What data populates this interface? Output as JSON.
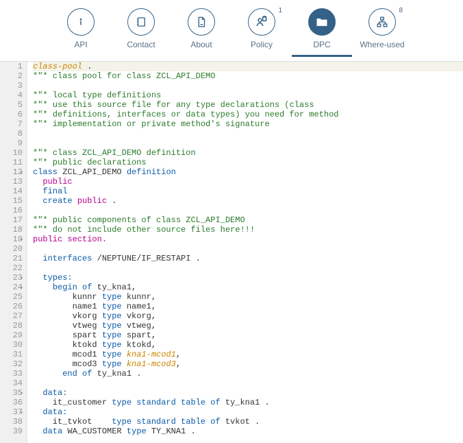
{
  "tabs": [
    {
      "id": "api",
      "label": "API",
      "icon": "info-icon",
      "badge": null,
      "active": false
    },
    {
      "id": "contact",
      "label": "Contact",
      "icon": "contact-icon",
      "badge": null,
      "active": false
    },
    {
      "id": "about",
      "label": "About",
      "icon": "document-icon",
      "badge": null,
      "active": false
    },
    {
      "id": "policy",
      "label": "Policy",
      "icon": "policy-icon",
      "badge": "1",
      "active": false
    },
    {
      "id": "dpc",
      "label": "DPC",
      "icon": "folder-icon",
      "badge": null,
      "active": true
    },
    {
      "id": "where-used",
      "label": "Where-used",
      "icon": "hierarchy-icon",
      "badge": "8",
      "active": false
    }
  ],
  "code_lines": [
    {
      "n": 1,
      "fold": "",
      "hl": true,
      "tokens": [
        [
          "cp",
          "class-pool"
        ],
        [
          "ident",
          " ."
        ]
      ]
    },
    {
      "n": 2,
      "fold": "",
      "hl": false,
      "tokens": [
        [
          "cmt",
          "*\"* class pool for class ZCL_API_DEMO"
        ]
      ]
    },
    {
      "n": 3,
      "fold": "",
      "hl": false,
      "tokens": [
        [
          "ident",
          ""
        ]
      ]
    },
    {
      "n": 4,
      "fold": "",
      "hl": false,
      "tokens": [
        [
          "cmt",
          "*\"* local type definitions"
        ]
      ]
    },
    {
      "n": 5,
      "fold": "",
      "hl": false,
      "tokens": [
        [
          "cmt",
          "*\"* use this source file for any type declarations (class"
        ]
      ]
    },
    {
      "n": 6,
      "fold": "",
      "hl": false,
      "tokens": [
        [
          "cmt",
          "*\"* definitions, interfaces or data types) you need for method"
        ]
      ]
    },
    {
      "n": 7,
      "fold": "",
      "hl": false,
      "tokens": [
        [
          "cmt",
          "*\"* implementation or private method's signature"
        ]
      ]
    },
    {
      "n": 8,
      "fold": "",
      "hl": false,
      "tokens": [
        [
          "ident",
          ""
        ]
      ]
    },
    {
      "n": 9,
      "fold": "",
      "hl": false,
      "tokens": [
        [
          "ident",
          ""
        ]
      ]
    },
    {
      "n": 10,
      "fold": "",
      "hl": false,
      "tokens": [
        [
          "cmt",
          "*\"* class ZCL_API_DEMO definition"
        ]
      ]
    },
    {
      "n": 11,
      "fold": "",
      "hl": false,
      "tokens": [
        [
          "cmt",
          "*\"* public declarations"
        ]
      ]
    },
    {
      "n": 12,
      "fold": "▾",
      "hl": false,
      "tokens": [
        [
          "kw",
          "class "
        ],
        [
          "ident",
          "ZCL_API_DEMO "
        ],
        [
          "kw",
          "definition"
        ]
      ]
    },
    {
      "n": 13,
      "fold": "",
      "hl": false,
      "tokens": [
        [
          "ident",
          "  "
        ],
        [
          "vis",
          "public"
        ]
      ]
    },
    {
      "n": 14,
      "fold": "",
      "hl": false,
      "tokens": [
        [
          "ident",
          "  "
        ],
        [
          "kw",
          "final"
        ]
      ]
    },
    {
      "n": 15,
      "fold": "",
      "hl": false,
      "tokens": [
        [
          "ident",
          "  "
        ],
        [
          "kw",
          "create "
        ],
        [
          "vis",
          "public"
        ],
        [
          "ident",
          " ."
        ]
      ]
    },
    {
      "n": 16,
      "fold": "",
      "hl": false,
      "tokens": [
        [
          "ident",
          ""
        ]
      ]
    },
    {
      "n": 17,
      "fold": "",
      "hl": false,
      "tokens": [
        [
          "cmt",
          "*\"* public components of class ZCL_API_DEMO"
        ]
      ]
    },
    {
      "n": 18,
      "fold": "",
      "hl": false,
      "tokens": [
        [
          "cmt",
          "*\"* do not include other source files here!!!"
        ]
      ]
    },
    {
      "n": 19,
      "fold": "▾",
      "hl": false,
      "tokens": [
        [
          "vis",
          "public "
        ],
        [
          "decl",
          "section."
        ]
      ]
    },
    {
      "n": 20,
      "fold": "",
      "hl": false,
      "tokens": [
        [
          "ident",
          ""
        ]
      ]
    },
    {
      "n": 21,
      "fold": "",
      "hl": false,
      "tokens": [
        [
          "ident",
          "  "
        ],
        [
          "kw",
          "interfaces "
        ],
        [
          "ident",
          "/NEPTUNE/IF_RESTAPI ."
        ]
      ]
    },
    {
      "n": 22,
      "fold": "",
      "hl": false,
      "tokens": [
        [
          "ident",
          ""
        ]
      ]
    },
    {
      "n": 23,
      "fold": "▾",
      "hl": false,
      "tokens": [
        [
          "ident",
          "  "
        ],
        [
          "kw",
          "types:"
        ]
      ]
    },
    {
      "n": 24,
      "fold": "▾",
      "hl": false,
      "tokens": [
        [
          "ident",
          "    "
        ],
        [
          "kw",
          "begin of "
        ],
        [
          "ident",
          "ty_kna1,"
        ]
      ]
    },
    {
      "n": 25,
      "fold": "",
      "hl": false,
      "tokens": [
        [
          "ident",
          "        kunnr "
        ],
        [
          "kw",
          "type "
        ],
        [
          "ident",
          "kunnr,"
        ]
      ]
    },
    {
      "n": 26,
      "fold": "",
      "hl": false,
      "tokens": [
        [
          "ident",
          "        name1 "
        ],
        [
          "kw",
          "type "
        ],
        [
          "ident",
          "name1,"
        ]
      ]
    },
    {
      "n": 27,
      "fold": "",
      "hl": false,
      "tokens": [
        [
          "ident",
          "        vkorg "
        ],
        [
          "kw",
          "type "
        ],
        [
          "ident",
          "vkorg,"
        ]
      ]
    },
    {
      "n": 28,
      "fold": "",
      "hl": false,
      "tokens": [
        [
          "ident",
          "        vtweg "
        ],
        [
          "kw",
          "type "
        ],
        [
          "ident",
          "vtweg,"
        ]
      ]
    },
    {
      "n": 29,
      "fold": "",
      "hl": false,
      "tokens": [
        [
          "ident",
          "        spart "
        ],
        [
          "kw",
          "type "
        ],
        [
          "ident",
          "spart,"
        ]
      ]
    },
    {
      "n": 30,
      "fold": "",
      "hl": false,
      "tokens": [
        [
          "ident",
          "        ktokd "
        ],
        [
          "kw",
          "type "
        ],
        [
          "ident",
          "ktokd,"
        ]
      ]
    },
    {
      "n": 31,
      "fold": "",
      "hl": false,
      "tokens": [
        [
          "ident",
          "        mcod1 "
        ],
        [
          "kw",
          "type "
        ],
        [
          "type",
          "kna1-mcod1"
        ],
        [
          "ident",
          ","
        ]
      ]
    },
    {
      "n": 32,
      "fold": "",
      "hl": false,
      "tokens": [
        [
          "ident",
          "        mcod3 "
        ],
        [
          "kw",
          "type "
        ],
        [
          "type",
          "kna1-mcod3"
        ],
        [
          "ident",
          ","
        ]
      ]
    },
    {
      "n": 33,
      "fold": "",
      "hl": false,
      "tokens": [
        [
          "ident",
          "      "
        ],
        [
          "kw",
          "end of "
        ],
        [
          "ident",
          "ty_kna1 ."
        ]
      ]
    },
    {
      "n": 34,
      "fold": "",
      "hl": false,
      "tokens": [
        [
          "ident",
          ""
        ]
      ]
    },
    {
      "n": 35,
      "fold": "▾",
      "hl": false,
      "tokens": [
        [
          "ident",
          "  "
        ],
        [
          "kw",
          "data:"
        ]
      ]
    },
    {
      "n": 36,
      "fold": "",
      "hl": false,
      "tokens": [
        [
          "ident",
          "    it_customer "
        ],
        [
          "kw",
          "type standard table of "
        ],
        [
          "ident",
          "ty_kna1 ."
        ]
      ]
    },
    {
      "n": 37,
      "fold": "▾",
      "hl": false,
      "tokens": [
        [
          "ident",
          "  "
        ],
        [
          "kw",
          "data:"
        ]
      ]
    },
    {
      "n": 38,
      "fold": "",
      "hl": false,
      "tokens": [
        [
          "ident",
          "    it_tvkot    "
        ],
        [
          "kw",
          "type standard table of "
        ],
        [
          "ident",
          "tvkot ."
        ]
      ]
    },
    {
      "n": 39,
      "fold": "",
      "hl": false,
      "tokens": [
        [
          "ident",
          "  "
        ],
        [
          "kw",
          "data "
        ],
        [
          "ident",
          "WA_CUSTOMER "
        ],
        [
          "kw",
          "type "
        ],
        [
          "ident",
          "TY_KNA1 ."
        ]
      ]
    }
  ]
}
